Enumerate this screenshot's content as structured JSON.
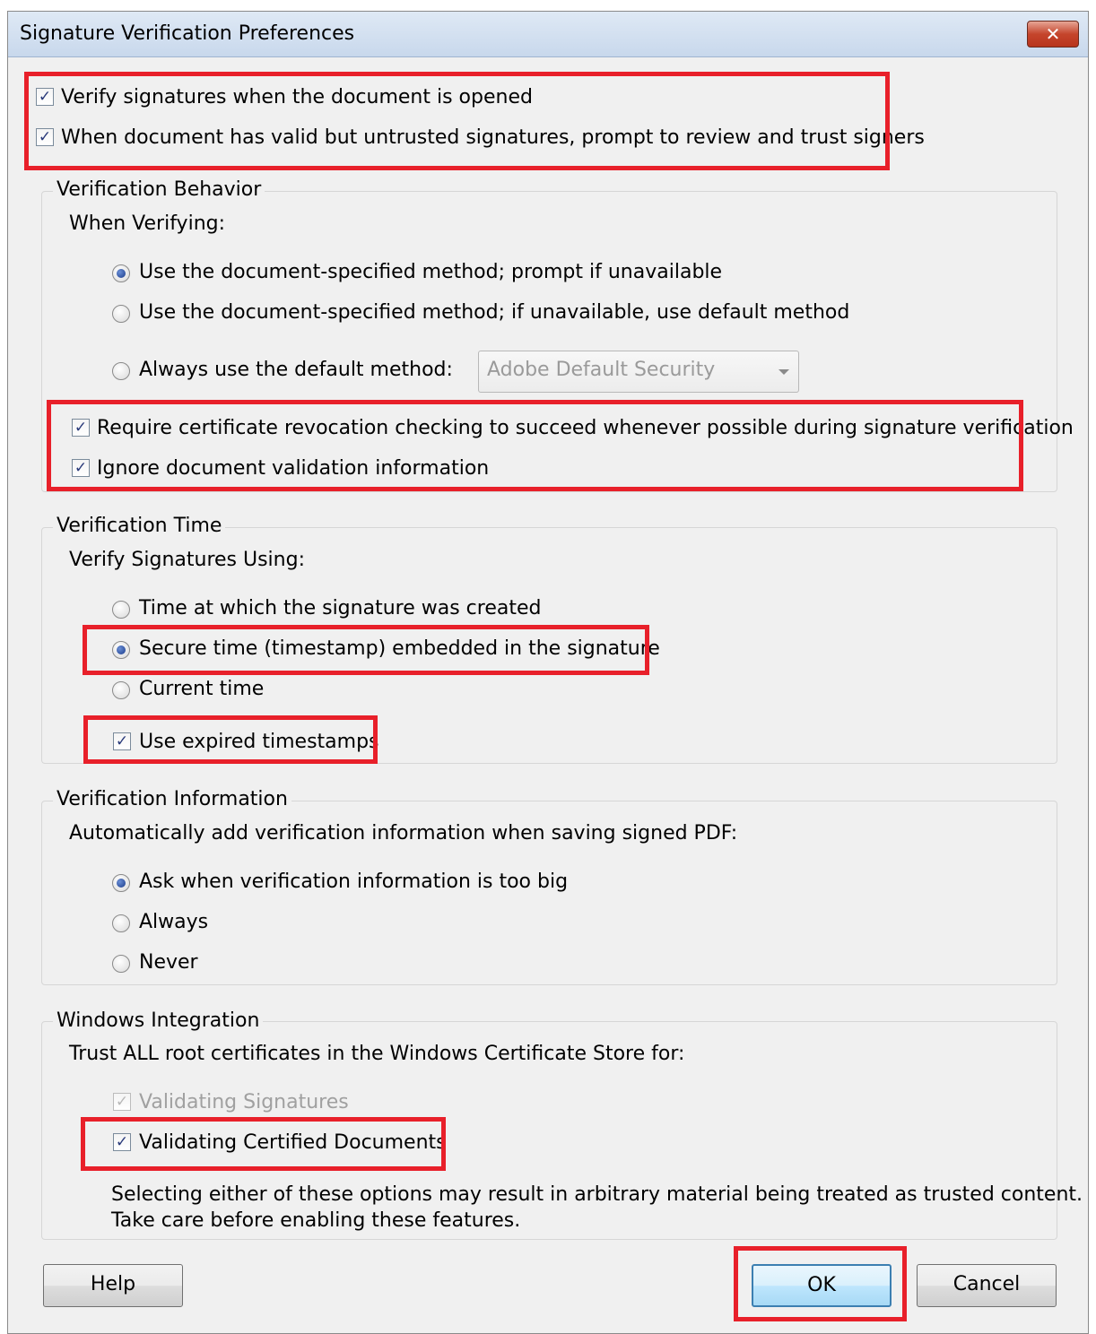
{
  "window": {
    "title": "Signature Verification Preferences",
    "close_glyph": "✕"
  },
  "top_options": [
    {
      "label": "Verify signatures when the document is opened",
      "checked": true
    },
    {
      "label": "When document has valid but untrusted signatures, prompt to review and trust signers",
      "checked": true
    }
  ],
  "verification_behavior": {
    "title": "Verification Behavior",
    "subtitle": "When Verifying:",
    "radios": [
      {
        "label": "Use the document-specified method; prompt if unavailable",
        "selected": true
      },
      {
        "label": "Use the document-specified method; if unavailable, use default method",
        "selected": false
      },
      {
        "label": "Always use the default method:",
        "selected": false
      }
    ],
    "default_method_dropdown": {
      "value": "Adobe Default Security",
      "enabled": false
    },
    "checkboxes": [
      {
        "label": "Require certificate revocation checking to succeed whenever possible during signature verification",
        "checked": true
      },
      {
        "label": "Ignore document validation information",
        "checked": true
      }
    ]
  },
  "verification_time": {
    "title": "Verification Time",
    "subtitle": "Verify Signatures Using:",
    "radios": [
      {
        "label": "Time at which the signature was created",
        "selected": false
      },
      {
        "label": "Secure time (timestamp) embedded in the signature",
        "selected": true
      },
      {
        "label": "Current time",
        "selected": false
      }
    ],
    "expired_timestamps": {
      "label": "Use expired timestamps",
      "checked": true
    }
  },
  "verification_information": {
    "title": "Verification Information",
    "subtitle": "Automatically add verification information when saving signed PDF:",
    "radios": [
      {
        "label": "Ask when verification information is too big",
        "selected": true
      },
      {
        "label": "Always",
        "selected": false
      },
      {
        "label": "Never",
        "selected": false
      }
    ]
  },
  "windows_integration": {
    "title": "Windows Integration",
    "subtitle": "Trust ALL root certificates in the Windows Certificate Store for:",
    "checkboxes": [
      {
        "label": "Validating Signatures",
        "checked": true,
        "enabled": false
      },
      {
        "label": "Validating Certified Documents",
        "checked": true,
        "enabled": true
      }
    ],
    "warning_line1": "Selecting either of these options may result in arbitrary material being treated as trusted content.",
    "warning_line2": "Take care before enabling these features."
  },
  "buttons": {
    "help": "Help",
    "ok": "OK",
    "cancel": "Cancel"
  },
  "check_glyph": "✓",
  "colors": {
    "highlight": "#e8202a",
    "dialog_bg": "#f0f0f0",
    "disabled_text": "#a0a0a0"
  }
}
